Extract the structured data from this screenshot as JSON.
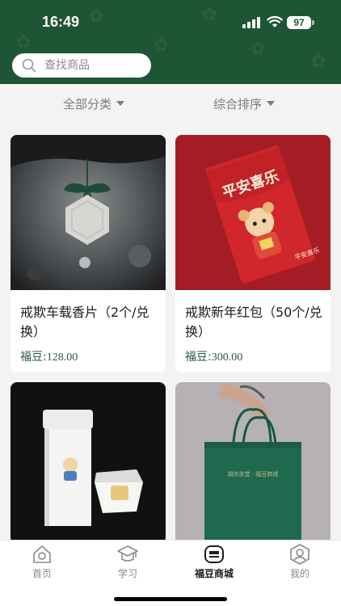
{
  "status_bar": {
    "time": "16:49",
    "battery": "97"
  },
  "search": {
    "placeholder": "查找商品"
  },
  "filters": {
    "category": "全部分类",
    "sort": "综合排序"
  },
  "products": [
    {
      "name": "戒欺车载香片（2个/兑换）",
      "price_label": "福豆:",
      "price": "128.00"
    },
    {
      "name": "戒欺新年红包（50个/兑换）",
      "price_label": "福豆:",
      "price": "300.00"
    }
  ],
  "product_images": {
    "envelope_title": "平安喜乐",
    "envelope_caption": "平安喜乐",
    "bag_brand": "胡庆余堂 · 福豆商城"
  },
  "tabbar": [
    {
      "label": "首页",
      "icon": "home-icon"
    },
    {
      "label": "学习",
      "icon": "graduation-cap-icon"
    },
    {
      "label": "福豆商城",
      "icon": "shop-icon"
    },
    {
      "label": "我的",
      "icon": "profile-icon"
    }
  ],
  "colors": {
    "header_green": "#1e5535",
    "envelope_red": "#b52028",
    "bag_green": "#1f6a4f",
    "price_green": "#2a5a3c"
  }
}
